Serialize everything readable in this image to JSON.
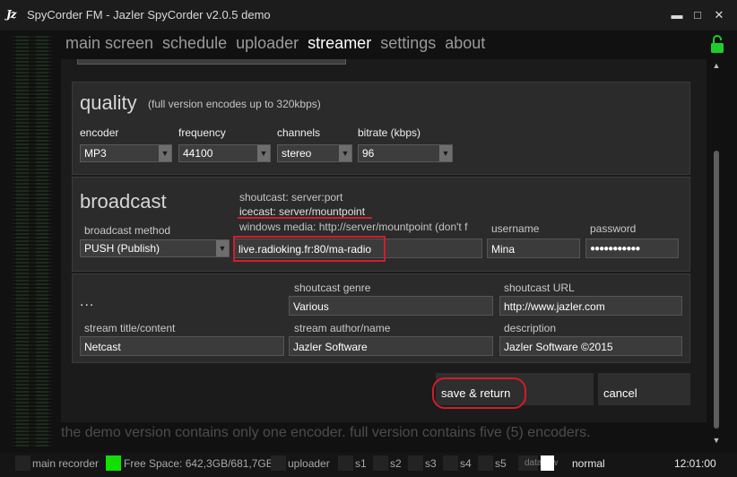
{
  "window": {
    "logo": "Jz",
    "title": "SpyCorder FM - Jazler SpyCorder v2.0.5 demo",
    "minimize_glyph": "▬",
    "maximize_glyph": "□",
    "close_glyph": "✕"
  },
  "nav": {
    "items": [
      "main screen",
      "schedule",
      "uploader",
      "streamer",
      "settings",
      "about"
    ],
    "active": "streamer"
  },
  "icons": {
    "lock": "unlocked-padlock-icon",
    "dropdown": "chevron-down-icon"
  },
  "quality": {
    "title": "quality",
    "note": "(full version encodes up to 320kbps)",
    "encoder": {
      "label": "encoder",
      "value": "MP3"
    },
    "frequency": {
      "label": "frequency",
      "value": "44100"
    },
    "channels": {
      "label": "channels",
      "value": "stereo"
    },
    "bitrate": {
      "label": "bitrate (kbps)",
      "value": "96"
    }
  },
  "broadcast": {
    "title": "broadcast",
    "hint_shoutcast": "shoutcast: server:port",
    "hint_icecast": "icecast: server/mountpoint",
    "hint_windows_media": "windows media: http://server/mountpoint  (don't f",
    "method": {
      "label": "broadcast method",
      "value": "PUSH (Publish)"
    },
    "server": {
      "value": "live.radioking.fr:80/ma-radio"
    },
    "username": {
      "label": "username",
      "value": "Mina"
    },
    "password": {
      "label": "password",
      "value": "●●●●●●●●●●●"
    }
  },
  "stream_info": {
    "ellipsis": "...",
    "genre": {
      "label": "shoutcast genre",
      "value": "Various"
    },
    "url": {
      "label": "shoutcast URL",
      "value": "http://www.jazler.com"
    },
    "title": {
      "label": "stream title/content",
      "value": "Netcast"
    },
    "author": {
      "label": "stream author/name",
      "value": "Jazler Software"
    },
    "description": {
      "label": "description",
      "value": "Jazler Software ©2015"
    }
  },
  "buttons": {
    "save": "save & return",
    "cancel": "cancel"
  },
  "demo_note": "the demo version contains only one encoder. full version contains five (5) encoders.",
  "status_bar": {
    "main_recorder": "main recorder",
    "free_space": "Free Space: 642,3GB/681,7GB",
    "uploader": "uploader",
    "slots": [
      "s1",
      "s2",
      "s3",
      "s4",
      "s5"
    ],
    "dataflow": "dataflow",
    "mode": "normal",
    "time": "12:01:00"
  },
  "colors": {
    "annotation_red": "#d11d2a",
    "active_led": "#13e000",
    "lock_green": "#1fcc2e"
  }
}
